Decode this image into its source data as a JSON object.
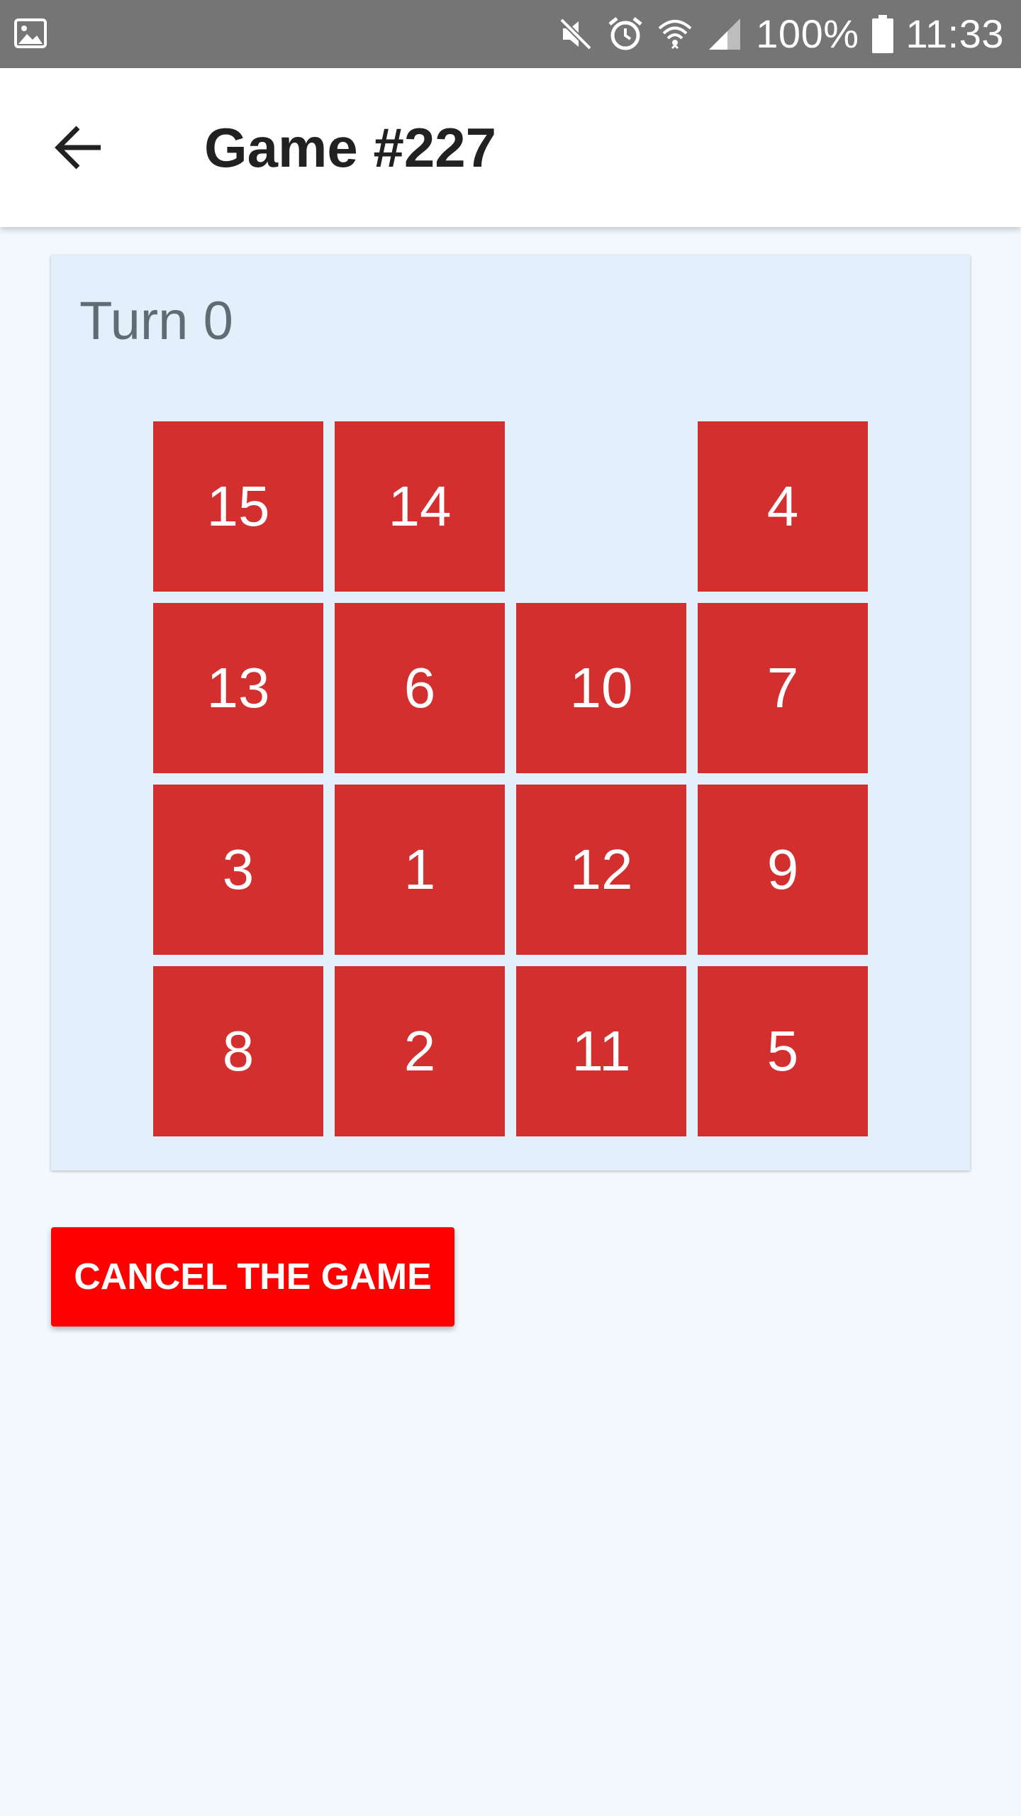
{
  "status_bar": {
    "battery_percent": "100%",
    "time": "11:33",
    "icons": [
      "image-icon",
      "mute-icon",
      "alarm-icon",
      "wifi-icon",
      "signal-icon",
      "battery-icon"
    ]
  },
  "app_bar": {
    "title": "Game #227",
    "back_icon": "arrow-left-icon"
  },
  "game": {
    "turn_label": "Turn 0",
    "tiles": [
      [
        "15",
        "14",
        "",
        "4"
      ],
      [
        "13",
        "6",
        "10",
        "7"
      ],
      [
        "3",
        "1",
        "12",
        "9"
      ],
      [
        "8",
        "2",
        "11",
        "5"
      ]
    ],
    "tile_color": "#d32f2f",
    "card_color": "#e3f0fb"
  },
  "actions": {
    "cancel_label": "CANCEL THE GAME",
    "cancel_color": "#ff0000"
  }
}
